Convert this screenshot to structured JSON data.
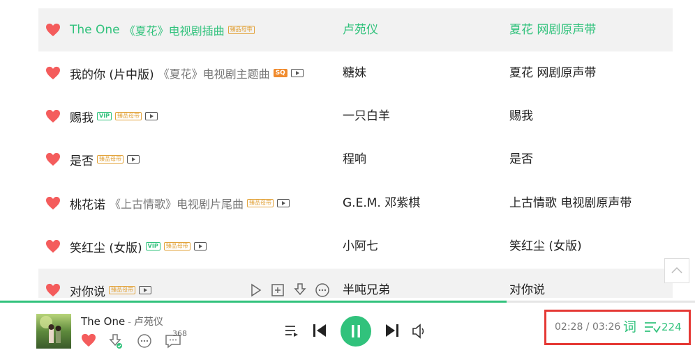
{
  "songs": [
    {
      "title": "The One",
      "subtitle": "《夏花》电视剧插曲",
      "tags": [
        "臻品母带"
      ],
      "mv": false,
      "artist": "卢苑仪",
      "album": "夏花 网剧原声带",
      "active": true
    },
    {
      "title": "我的你 (片中版)",
      "subtitle": "《夏花》电视剧主题曲",
      "tags": [
        "SQ"
      ],
      "mv": true,
      "artist": "糖妹",
      "album": "夏花 网剧原声带",
      "active": false
    },
    {
      "title": "赐我",
      "subtitle": "",
      "tags": [
        "VIP",
        "臻品母带"
      ],
      "mv": true,
      "artist": "一只白羊",
      "album": "赐我",
      "active": false
    },
    {
      "title": "是否",
      "subtitle": "",
      "tags": [
        "臻品母带"
      ],
      "mv": true,
      "artist": "程响",
      "album": "是否",
      "active": false
    },
    {
      "title": "桃花诺",
      "subtitle": "《上古情歌》电视剧片尾曲",
      "tags": [
        "臻品母带"
      ],
      "mv": true,
      "artist": "G.E.M. 邓紫棋",
      "album": "上古情歌 电视剧原声带",
      "active": false
    },
    {
      "title": "笑红尘 (女版)",
      "subtitle": "",
      "tags": [
        "VIP",
        "臻品母带"
      ],
      "mv": true,
      "artist": "小阿七",
      "album": "笑红尘 (女版)",
      "active": false
    },
    {
      "title": "对你说",
      "subtitle": "",
      "tags": [
        "臻品母带"
      ],
      "mv": true,
      "artist": "半吨兄弟",
      "album": "对你说",
      "active": false
    }
  ],
  "player": {
    "title": "The One",
    "separator": "-",
    "artist": "卢苑仪",
    "comment_count": "368",
    "progress": 0.729,
    "current_time": "02:28",
    "total_time": "03:26",
    "time_separator": " / ",
    "lyric_label": "词",
    "playlist_count": "224"
  },
  "colors": {
    "accent": "#31c27c",
    "heart": "#f45c5c",
    "highlight_box": "#e53935",
    "tag_master": "#e2a33b"
  },
  "icons": [
    "heart-icon",
    "mv-icon",
    "play-icon",
    "add-icon",
    "download-icon",
    "more-icon",
    "scroll-top-icon",
    "playlist-mode-icon",
    "prev-icon",
    "pause-icon",
    "next-icon",
    "volume-icon",
    "comment-icon",
    "playlist-icon"
  ]
}
